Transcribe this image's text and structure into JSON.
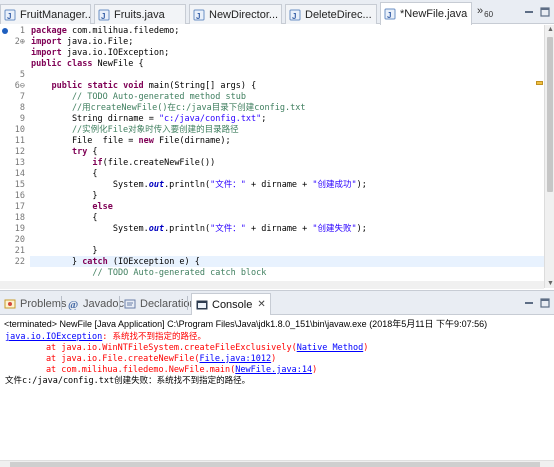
{
  "editor_tabs": [
    {
      "label": "FruitManager...",
      "close": "",
      "active": false
    },
    {
      "label": "Fruits.java",
      "close": "",
      "active": false
    },
    {
      "label": "NewDirector...",
      "close": "",
      "active": false
    },
    {
      "label": "DeleteDirec...",
      "close": "",
      "active": false
    },
    {
      "label": "*NewFile.java",
      "close": "✕",
      "active": true
    }
  ],
  "overflow": {
    "chevron": "»",
    "count": "60"
  },
  "editor": {
    "line_numbers": [
      "1",
      "2⊕",
      "",
      "",
      "5",
      "6⊖",
      "7",
      "8",
      "9",
      "10",
      "11",
      "12",
      "13",
      "14",
      "15",
      "16",
      "17",
      "18",
      "19",
      "20",
      "21",
      "22",
      ""
    ],
    "lines": [
      {
        "parts": [
          {
            "t": "package",
            "c": "kw"
          },
          {
            "t": " com.milihua.filedemo;",
            "c": ""
          }
        ]
      },
      {
        "parts": [
          {
            "t": "import",
            "c": "kw"
          },
          {
            "t": " java.io.File;",
            "c": ""
          }
        ]
      },
      {
        "parts": [
          {
            "t": "import",
            "c": "kw"
          },
          {
            "t": " java.io.IOException;",
            "c": ""
          }
        ]
      },
      {
        "parts": [
          {
            "t": "public",
            "c": "kw"
          },
          {
            "t": " ",
            "c": ""
          },
          {
            "t": "class",
            "c": "kw"
          },
          {
            "t": " NewFile {",
            "c": ""
          }
        ]
      },
      {
        "parts": []
      },
      {
        "parts": [
          {
            "t": "    ",
            "c": ""
          },
          {
            "t": "public",
            "c": "kw"
          },
          {
            "t": " ",
            "c": ""
          },
          {
            "t": "static",
            "c": "kw"
          },
          {
            "t": " ",
            "c": ""
          },
          {
            "t": "void",
            "c": "kw"
          },
          {
            "t": " main(String[] args) {",
            "c": ""
          }
        ]
      },
      {
        "parts": [
          {
            "t": "        // TODO Auto-generated method stub",
            "c": "cm"
          }
        ]
      },
      {
        "parts": [
          {
            "t": "        //用createNewFile()在c:/java目录下创建config.txt",
            "c": "cm"
          }
        ]
      },
      {
        "parts": [
          {
            "t": "        String dirname = ",
            "c": ""
          },
          {
            "t": "\"c:/java/config.txt\"",
            "c": "st"
          },
          {
            "t": ";",
            "c": ""
          }
        ]
      },
      {
        "parts": [
          {
            "t": "        //实例化File对象时传入要创建的目录路径",
            "c": "cm"
          }
        ]
      },
      {
        "parts": [
          {
            "t": "        File  file = ",
            "c": ""
          },
          {
            "t": "new",
            "c": "kw"
          },
          {
            "t": " File(dirname);",
            "c": ""
          }
        ]
      },
      {
        "parts": [
          {
            "t": "        ",
            "c": ""
          },
          {
            "t": "try",
            "c": "kw"
          },
          {
            "t": " {",
            "c": ""
          }
        ]
      },
      {
        "parts": [
          {
            "t": "            ",
            "c": ""
          },
          {
            "t": "if",
            "c": "kw"
          },
          {
            "t": "(file.createNewFile())",
            "c": ""
          }
        ]
      },
      {
        "parts": [
          {
            "t": "            {",
            "c": ""
          }
        ]
      },
      {
        "parts": [
          {
            "t": "                System.",
            "c": ""
          },
          {
            "t": "out",
            "c": "fld"
          },
          {
            "t": ".println(",
            "c": ""
          },
          {
            "t": "\"文件：\"",
            "c": "st"
          },
          {
            "t": " + dirname + ",
            "c": ""
          },
          {
            "t": "\"创建成功\"",
            "c": "st"
          },
          {
            "t": ");",
            "c": ""
          }
        ]
      },
      {
        "parts": [
          {
            "t": "            }",
            "c": ""
          }
        ]
      },
      {
        "parts": [
          {
            "t": "            ",
            "c": ""
          },
          {
            "t": "else",
            "c": "kw"
          }
        ]
      },
      {
        "parts": [
          {
            "t": "            {",
            "c": ""
          }
        ]
      },
      {
        "parts": [
          {
            "t": "                System.",
            "c": ""
          },
          {
            "t": "out",
            "c": "fld"
          },
          {
            "t": ".println(",
            "c": ""
          },
          {
            "t": "\"文件：\"",
            "c": "st"
          },
          {
            "t": " + dirname + ",
            "c": ""
          },
          {
            "t": "\"创建失败\"",
            "c": "st"
          },
          {
            "t": ");",
            "c": ""
          }
        ]
      },
      {
        "parts": []
      },
      {
        "parts": [
          {
            "t": "            }",
            "c": ""
          }
        ]
      },
      {
        "parts": [
          {
            "t": "        } ",
            "c": ""
          },
          {
            "t": "catch",
            "c": "kw"
          },
          {
            "t": " (IOException e) {",
            "c": ""
          }
        ]
      },
      {
        "parts": [
          {
            "t": "            // TODO Auto-generated catch block",
            "c": "cm"
          }
        ]
      }
    ]
  },
  "views": {
    "problems": "Problems",
    "javadoc": "Javadoc",
    "declaration": "Declaration",
    "console": "Console",
    "console_close": "✕"
  },
  "console": {
    "terminated": "<terminated> NewFile [Java Application] C:\\Program Files\\Java\\jdk1.8.0_151\\bin\\javaw.exe (2018年5月11日 下午9:07:56)",
    "lines": [
      {
        "parts": [
          {
            "t": "java.io.IOException",
            "c": "lnk"
          },
          {
            "t": ": 系统找不到指定的路径。",
            "c": "err"
          }
        ]
      },
      {
        "parts": [
          {
            "t": "\tat java.io.WinNTFileSystem.createFileExclusively(",
            "c": "err"
          },
          {
            "t": "Native Method",
            "c": "lnk"
          },
          {
            "t": ")",
            "c": "err"
          }
        ]
      },
      {
        "parts": [
          {
            "t": "\tat java.io.File.createNewFile(",
            "c": "err"
          },
          {
            "t": "File.java:1012",
            "c": "lnk"
          },
          {
            "t": ")",
            "c": "err"
          }
        ]
      },
      {
        "parts": [
          {
            "t": "\tat com.milihua.filedemo.NewFile.main(",
            "c": "err"
          },
          {
            "t": "NewFile.java:14",
            "c": "lnk"
          },
          {
            "t": ")",
            "c": "err"
          }
        ]
      },
      {
        "parts": [
          {
            "t": "文件c:/java/config.txt创建失败：系统找不到指定的路径。",
            "c": "out"
          }
        ]
      }
    ]
  },
  "colors": {
    "keyword": "#7f0055",
    "comment": "#3f7f5f",
    "string": "#2a00ff",
    "error": "#ff0000",
    "link": "#0000ff",
    "current_line": "#e8f2fe"
  }
}
